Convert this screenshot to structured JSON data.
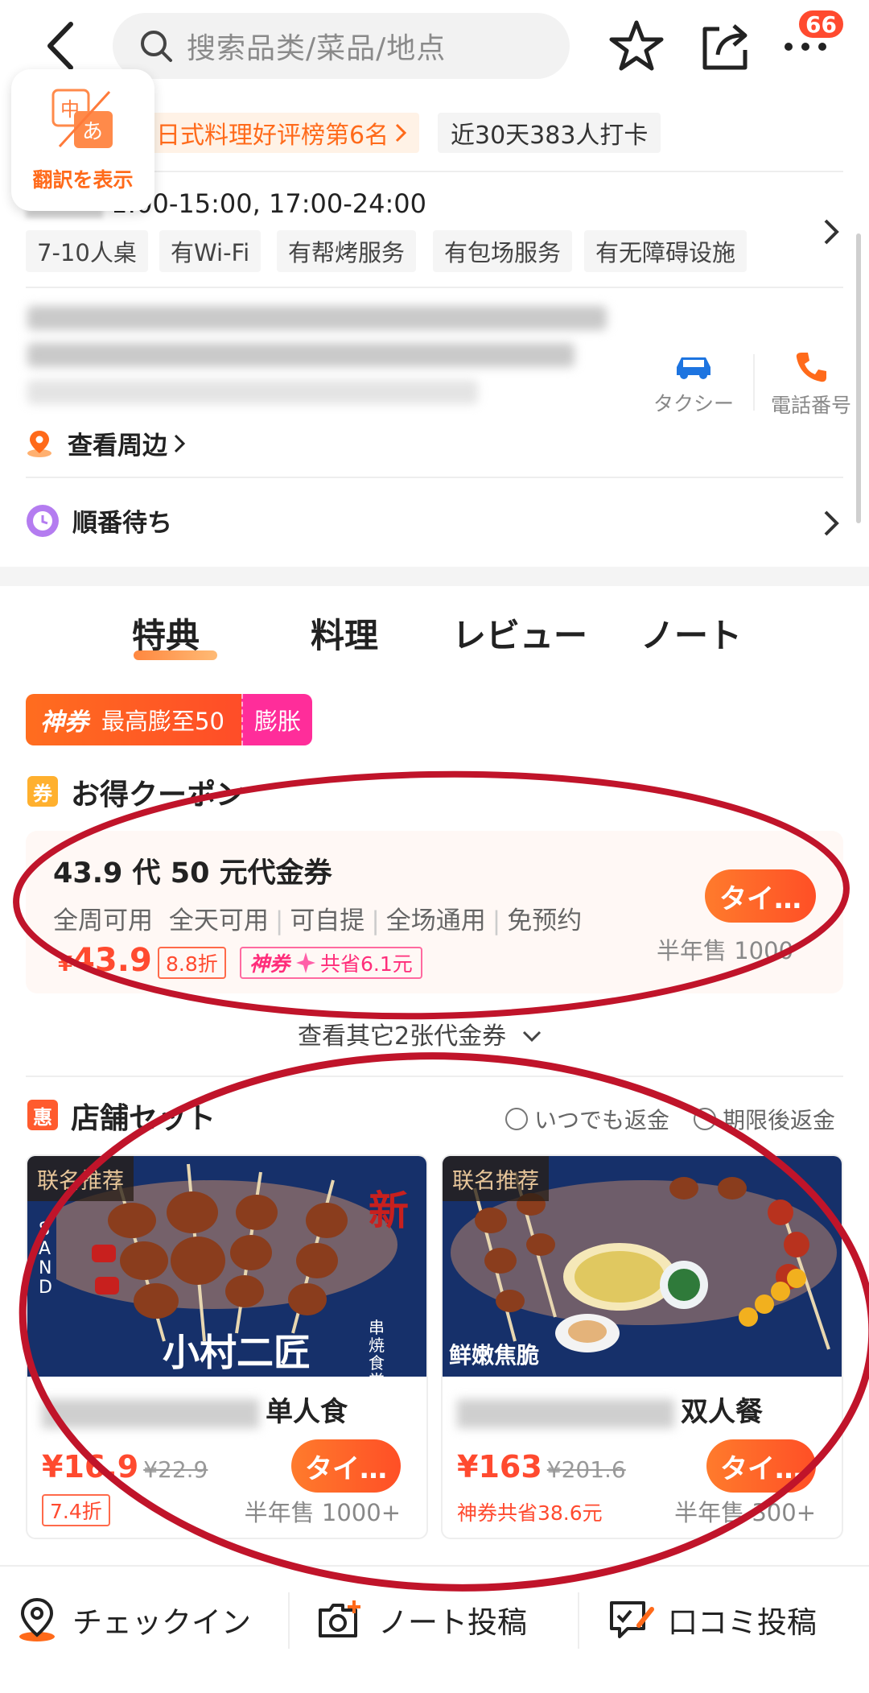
{
  "header": {
    "search_placeholder": "搜索品类/菜品/地点",
    "notification_count": "66"
  },
  "translate": {
    "label": "翻訳を表示"
  },
  "shop": {
    "rank_tag": "日式料理好评榜第6名",
    "checkin_tag": "近30天383人打卡",
    "hours": "1:00-15:00, 17:00-24:00",
    "features": [
      "7-10人桌",
      "有Wi-Fi",
      "有帮烤服务",
      "有包场服务",
      "有无障碍设施"
    ],
    "taxi_label": "タクシー",
    "phone_label": "電話番号",
    "nearby_label": "查看周边",
    "queue_label": "順番待ち"
  },
  "tabs": [
    "特典",
    "料理",
    "レビュー",
    "ノート"
  ],
  "promo": {
    "shenquan": "神券",
    "max_text": "最高膨至50",
    "expand_label": "膨胀"
  },
  "coupons": {
    "section_icon": "券",
    "section_title": "お得クーポン",
    "title": "43.9 代 50 元代金券",
    "meta": [
      "全周可用",
      "全天可用",
      "可自提",
      "全场通用",
      "免预约"
    ],
    "price": "43.9",
    "discount": "8.8折",
    "save_brand": "神券",
    "save_text": "共省6.1元",
    "buy_label": "タイ…",
    "sold": "半年售 1000",
    "more_label": "查看其它2张代金券"
  },
  "sets": {
    "section_icon": "惠",
    "section_title": "店舗セット",
    "return1": "いつでも返金",
    "return2": "期限後返金",
    "items": [
      {
        "tag": "联名推荐",
        "name_suffix": "单人食",
        "price": "¥16.9",
        "orig": "¥22.9",
        "discount": "7.4折",
        "buy_label": "タイ…",
        "sold": "半年售 1000+",
        "art_text": "小村二匠",
        "art_sub": "串焼食堂",
        "art_new": "新"
      },
      {
        "tag": "联名推荐",
        "name_suffix": "双人餐",
        "price": "¥163",
        "orig": "¥201.6",
        "save": "神券共省38.6元",
        "buy_label": "タイ…",
        "sold": "半年售 300+",
        "art_text": "鲜嫩焦脆"
      }
    ]
  },
  "bottom": {
    "checkin": "チェックイン",
    "note": "ノート投稿",
    "review": "口コミ投稿"
  },
  "colors": {
    "accent": "#ff6a1a",
    "price": "#ff4a2f",
    "annotation": "#c0142a"
  }
}
